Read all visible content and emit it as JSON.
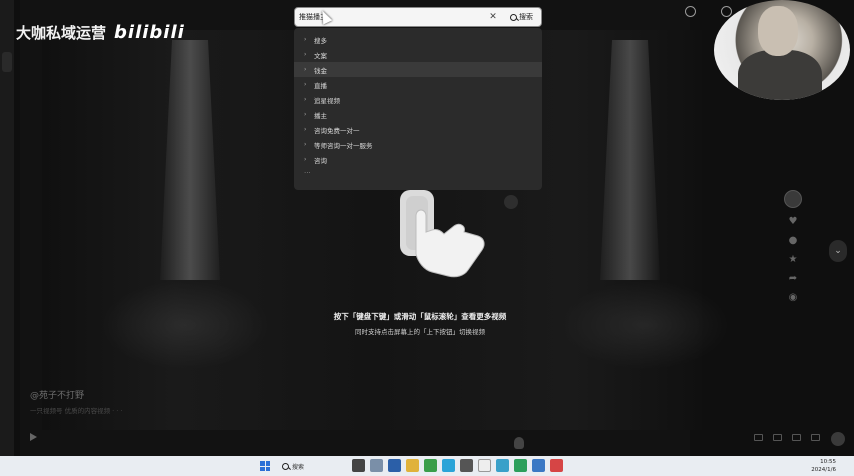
{
  "watermark": {
    "brand_text": "大咖私域运营",
    "logo_text": "bilibili"
  },
  "search": {
    "value": "推猫播主",
    "search_label": "搜索"
  },
  "suggestions": [
    {
      "label": "搜多"
    },
    {
      "label": "文案"
    },
    {
      "label": "钱金"
    },
    {
      "label": "直播"
    },
    {
      "label": "追星视频"
    },
    {
      "label": "播主"
    },
    {
      "label": "咨询免费一对一"
    },
    {
      "label": "等师咨询一对一服务"
    },
    {
      "label": "咨询"
    }
  ],
  "suggestions_more": "...",
  "guide": {
    "line1": "按下「键盘下键」或滑动「鼠标滚轮」查看更多视频",
    "line2": "同时支持点击屏幕上的「上下按钮」切换视频"
  },
  "video": {
    "author": "@苑子不打野",
    "description": "一只视频号 优质的内容视频 · · ·"
  },
  "taskbar": {
    "search_label": "搜索",
    "time": "10:55",
    "date": "2024/1/6"
  },
  "colors": {
    "taskbar_bg": "#e9edf2",
    "start_blue": "#2a6fd6",
    "suggest_bg": "#2b2b2b"
  }
}
